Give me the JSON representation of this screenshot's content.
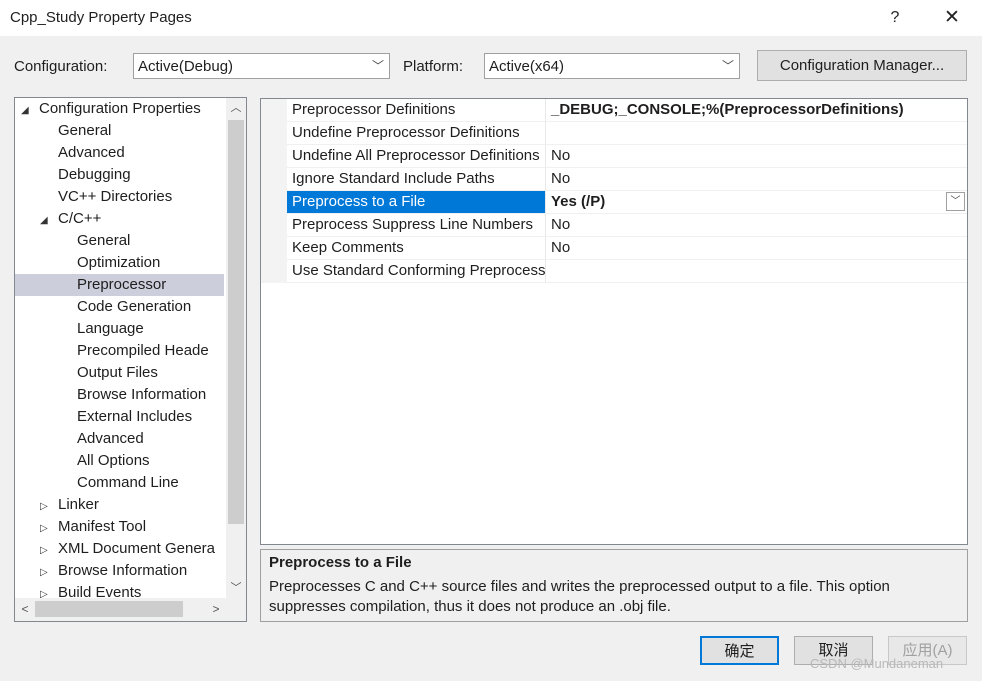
{
  "window": {
    "title": "Cpp_Study Property Pages",
    "help_glyph": "?",
    "close_glyph": "✕"
  },
  "toolbar": {
    "configuration_label": "Configuration:",
    "configuration_value": "Active(Debug)",
    "platform_label": "Platform:",
    "platform_value": "Active(x64)",
    "config_manager_label": "Configuration Manager..."
  },
  "tree": {
    "items": [
      {
        "label": "Configuration Properties",
        "toggle": "◢"
      },
      {
        "label": "General",
        "toggle": ""
      },
      {
        "label": "Advanced",
        "toggle": ""
      },
      {
        "label": "Debugging",
        "toggle": ""
      },
      {
        "label": "VC++ Directories",
        "toggle": ""
      },
      {
        "label": "C/C++",
        "toggle": "◢"
      },
      {
        "label": "General",
        "toggle": ""
      },
      {
        "label": "Optimization",
        "toggle": ""
      },
      {
        "label": "Preprocessor",
        "toggle": ""
      },
      {
        "label": "Code Generation",
        "toggle": ""
      },
      {
        "label": "Language",
        "toggle": ""
      },
      {
        "label": "Precompiled Heade",
        "toggle": ""
      },
      {
        "label": "Output Files",
        "toggle": ""
      },
      {
        "label": "Browse Information",
        "toggle": ""
      },
      {
        "label": "External Includes",
        "toggle": ""
      },
      {
        "label": "Advanced",
        "toggle": ""
      },
      {
        "label": "All Options",
        "toggle": ""
      },
      {
        "label": "Command Line",
        "toggle": ""
      },
      {
        "label": "Linker",
        "toggle": "▷"
      },
      {
        "label": "Manifest Tool",
        "toggle": "▷"
      },
      {
        "label": "XML Document Genera",
        "toggle": "▷"
      },
      {
        "label": "Browse Information",
        "toggle": "▷"
      },
      {
        "label": "Build Events",
        "toggle": "▷"
      }
    ],
    "selected": "Preprocessor"
  },
  "properties": {
    "rows": [
      {
        "name": "Preprocessor Definitions",
        "value": "_DEBUG;_CONSOLE;%(PreprocessorDefinitions)"
      },
      {
        "name": "Undefine Preprocessor Definitions",
        "value": ""
      },
      {
        "name": "Undefine All Preprocessor Definitions",
        "value": "No"
      },
      {
        "name": "Ignore Standard Include Paths",
        "value": "No"
      },
      {
        "name": "Preprocess to a File",
        "value": "Yes (/P)"
      },
      {
        "name": "Preprocess Suppress Line Numbers",
        "value": "No"
      },
      {
        "name": "Keep Comments",
        "value": "No"
      },
      {
        "name": "Use Standard Conforming Preprocessor",
        "value": ""
      }
    ],
    "selected": "Preprocess to a File"
  },
  "description": {
    "title": "Preprocess to a File",
    "body": "Preprocesses C and C++ source files and writes the preprocessed output to a file. This option suppresses compilation, thus it does not produce an .obj file."
  },
  "buttons": {
    "ok": "确定",
    "cancel": "取消",
    "apply": "应用(A)"
  },
  "watermark": "CSDN @Mundaneman",
  "colors": {
    "selection_blue": "#0078d7",
    "tree_selection": "#cccedb"
  }
}
